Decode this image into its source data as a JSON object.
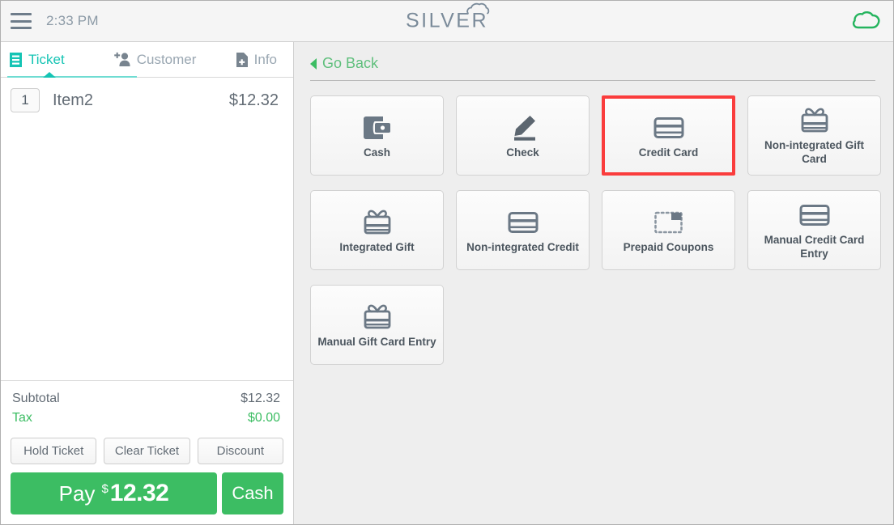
{
  "topbar": {
    "menu_icon": "hamburger-icon",
    "time": "2:33 PM",
    "logo_text": "SILVER",
    "logo_icon": "cloud-icon",
    "status_icon": "cloud-icon",
    "status_color": "#25b45e"
  },
  "left_panel": {
    "tabs": [
      {
        "label": "Ticket",
        "icon": "receipt-icon",
        "active": true
      },
      {
        "label": "Customer",
        "icon": "add-person-icon",
        "active": false
      },
      {
        "label": "Info",
        "icon": "add-document-icon",
        "active": false
      }
    ],
    "items": [
      {
        "qty": "1",
        "name": "Item2",
        "price": "$12.32"
      }
    ],
    "totals": [
      {
        "label": "Subtotal",
        "value": "$12.32",
        "color": "#636c75"
      },
      {
        "label": "Tax",
        "value": "$0.00",
        "color": "#3cbd63"
      }
    ],
    "action_buttons": [
      {
        "label": "Hold Ticket"
      },
      {
        "label": "Clear Ticket"
      },
      {
        "label": "Discount"
      }
    ],
    "pay": {
      "word": "Pay",
      "currency": "$",
      "amount": "12.32",
      "cash_label": "Cash",
      "color": "#3cbd63"
    }
  },
  "right_panel": {
    "go_back": {
      "label": "Go Back",
      "icon": "chevron-left-icon",
      "color": "#5fbf7c"
    },
    "selected_tile": "Credit Card",
    "selection_color": "#fa3c3c",
    "tiles": [
      {
        "label": "Cash",
        "icon": "wallet-icon",
        "selected": false
      },
      {
        "label": "Check",
        "icon": "pencil-icon",
        "selected": false
      },
      {
        "label": "Credit Card",
        "icon": "credit-card-icon",
        "selected": true
      },
      {
        "label": "Non-integrated Gift Card",
        "icon": "gift-card-icon",
        "selected": false
      },
      {
        "label": "Integrated Gift",
        "icon": "gift-card-icon",
        "selected": false
      },
      {
        "label": "Non-integrated Credit",
        "icon": "credit-card-icon",
        "selected": false
      },
      {
        "label": "Prepaid Coupons",
        "icon": "coupon-icon",
        "selected": false
      },
      {
        "label": "Manual Credit Card Entry",
        "icon": "credit-card-icon",
        "selected": false
      },
      {
        "label": "Manual Gift Card Entry",
        "icon": "gift-card-icon",
        "selected": false
      }
    ]
  }
}
